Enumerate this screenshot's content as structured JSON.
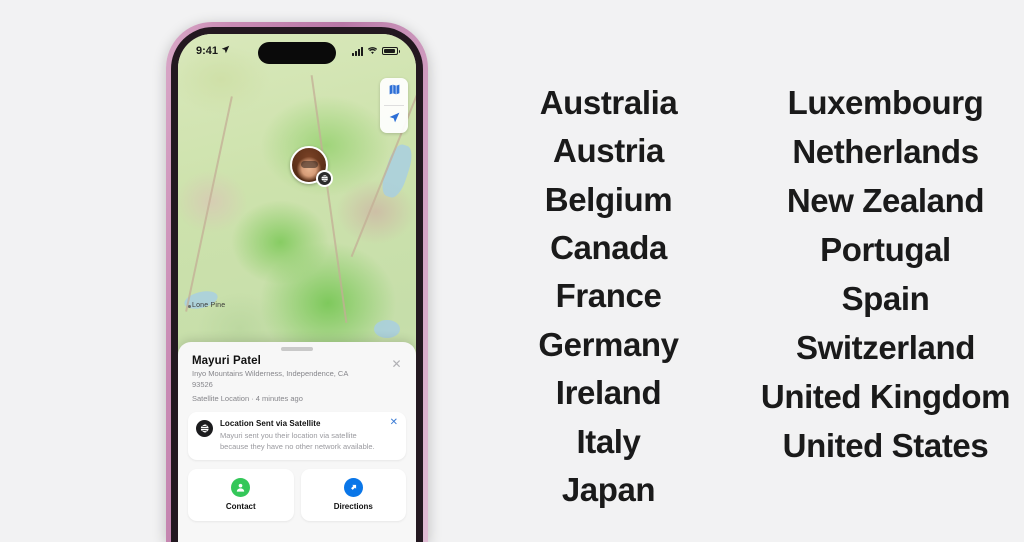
{
  "background_color": "#f2f2f3",
  "phone": {
    "frame_color": "#c98bb4",
    "status_bar": {
      "time": "9:41",
      "location_arrow_icon": "location-arrow-icon",
      "signal_icon": "cellular-signal-icon",
      "wifi_icon": "wifi-icon",
      "battery_icon": "battery-icon"
    },
    "map": {
      "layers_button_icon": "map-layers-icon",
      "locate_button_icon": "location-arrow-icon",
      "place_label": "Lone Pine",
      "avatar_icon": "person-avatar",
      "satellite_badge_icon": "satellite-icon"
    },
    "sheet": {
      "title": "Mayuri Patel",
      "address": "Inyo Mountains Wilderness, Independence, CA  93526",
      "meta": "Satellite Location · 4 minutes ago",
      "close_icon": "close-icon"
    },
    "banner": {
      "icon": "satellite-icon",
      "title": "Location Sent via Satellite",
      "text": "Mayuri sent you their location via satellite because they have no other network available.",
      "close_icon": "close-icon",
      "close_color": "#3a7bd5"
    },
    "actions": [
      {
        "label": "Contact",
        "icon": "contact-person-icon",
        "color": "#34c759"
      },
      {
        "label": "Directions",
        "icon": "directions-arrow-icon",
        "color": "#0a76e8"
      }
    ]
  },
  "countries": {
    "left_column": [
      "Australia",
      "Austria",
      "Belgium",
      "Canada",
      "France",
      "Germany",
      "Ireland",
      "Italy",
      "Japan"
    ],
    "right_column": [
      "Luxembourg",
      "Netherlands",
      "New Zealand",
      "Portugal",
      "Spain",
      "Switzerland",
      "United Kingdom",
      "United States"
    ]
  }
}
